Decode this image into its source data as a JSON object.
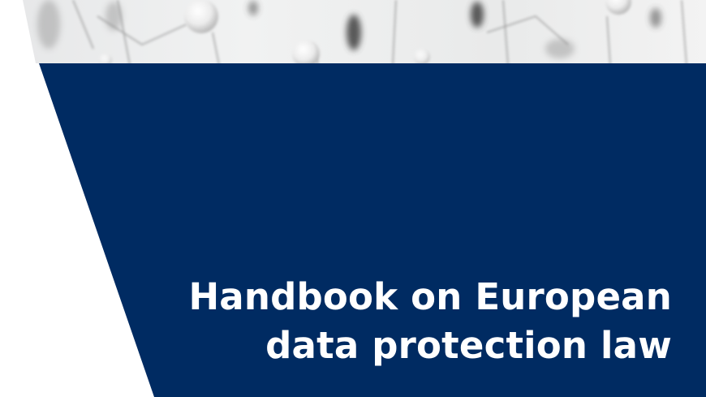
{
  "cover": {
    "title_lines": [
      "Handbook on European",
      "data protection law"
    ],
    "image": "pins-and-threads-photo",
    "colors": {
      "panel": "#002b62",
      "title_text": "#ffffff",
      "background": "#ffffff",
      "photo_light": "#eceeef",
      "photo_shadow": "#4a4a4a"
    }
  }
}
